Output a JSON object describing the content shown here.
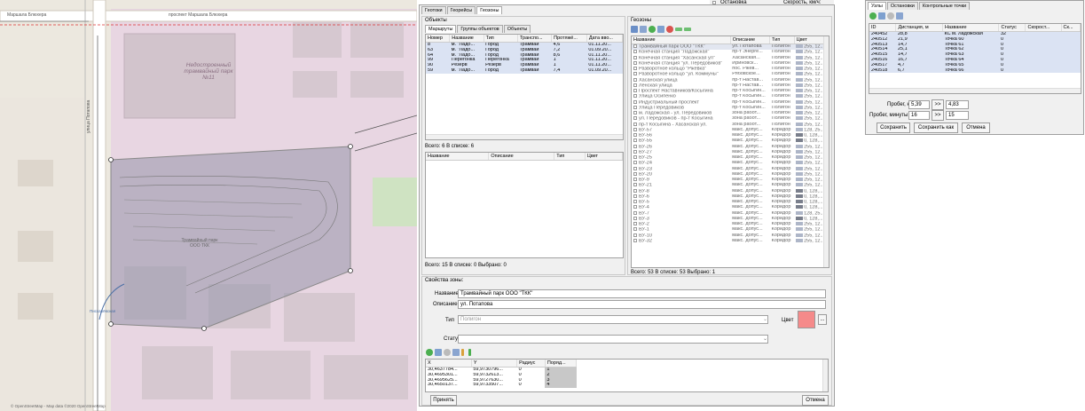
{
  "map": {
    "street_top": "проспект Маршала Блюхера",
    "street_left": "Маршала Блюхера",
    "street_vertical": "улица Потапова",
    "building_label": "Недостроенный трамвайный парк №11",
    "depot_label": "Трамвайный парк ООО ТКК",
    "street_bottom": "Пискарёвская",
    "attribution": "© OpenStreetMap - Map data ©2020 OpenStreetMap"
  },
  "top_strip": {
    "checkbox_label": "Остановка",
    "speed_label": "Скорость, км/ч:"
  },
  "main_tabs": [
    "Геотоки",
    "Георейсы",
    "Геозоны"
  ],
  "objects": {
    "title": "Объекты",
    "tabs": [
      "Маршруты",
      "Группы объектов",
      "Объекты"
    ],
    "columns": [
      "Номер",
      "Название",
      "Тип",
      "Транспо...",
      "Протяжё...",
      "Дата вво..."
    ],
    "rows": [
      [
        "8",
        "м. \"Ладо...",
        "Город",
        "Трамваи",
        "4,6",
        "01.11.20..."
      ],
      [
        "63",
        "м. \"Ладо...",
        "Город",
        "Трамваи",
        "7,2",
        "01.09.20..."
      ],
      [
        "64",
        "м. \"Ладо...",
        "Город",
        "Трамваи",
        "8,6",
        "01.11.20..."
      ],
      [
        "99",
        "Перегонка",
        "Перегонка",
        "Трамваи",
        "1",
        "01.11.20..."
      ],
      [
        "90",
        "Резерв",
        "Резерв",
        "Трамваи",
        "1",
        "01.11.20..."
      ],
      [
        "59",
        "м. \"Ладо...",
        "Город",
        "Трамваи",
        "7,4",
        "01.09.20..."
      ]
    ],
    "count_text": "Всего: 6  В списке: 6",
    "sub_columns": [
      "Название",
      "Описание",
      "Тип",
      "Цвет"
    ],
    "bottom_count": "Всего: 15  В списке: 0  Выбрано: 0"
  },
  "geozones": {
    "title": "Геозоны",
    "columns": [
      "Название",
      "Описание",
      "Тип",
      "Цвет"
    ],
    "rows": [
      [
        "Трамвайный парк ООО \"ТКК\"",
        "ул. Потапова",
        "Полигон",
        "255, 12..."
      ],
      [
        "Конечная станция \"Ладожская\"",
        "пр-т Энерге...",
        "Полигон",
        "255, 12..."
      ],
      [
        "Конечная станция \"Хасанская ул\"",
        "Хасанская...",
        "Полигон",
        "255, 12..."
      ],
      [
        "Конечная станция \"ул. Передовиков\"",
        "Ириновск...",
        "Полигон",
        "255, 12..."
      ],
      [
        "Разворотное кольцо \"Ржевка\"",
        "пос. Ржев...",
        "Полигон",
        "255, 12..."
      ],
      [
        "Разворотное кольцо \"ул. Коммуны\"",
        "Рябовское...",
        "Полигон",
        "255, 12..."
      ],
      [
        "Хасанская улица",
        "пр-т Настав...",
        "Полигон",
        "255, 12..."
      ],
      [
        "Ленская улица",
        "пр-т Настав...",
        "Полигон",
        "255, 12..."
      ],
      [
        "Проспект Наставников/Косыгина",
        "пр-т Косыгин...",
        "Полигон",
        "255, 12..."
      ],
      [
        "Улица Осипенко",
        "пр-т Косыгин...",
        "Полигон",
        "255, 12..."
      ],
      [
        "Индустриальный проспект",
        "пр-т Косыгин...",
        "Полигон",
        "255, 12..."
      ],
      [
        "Улица Передовиков",
        "пр-т Косыгин...",
        "Полигон",
        "255, 12..."
      ],
      [
        "м. Ладожская - ул. Передовиков",
        "зона работ...",
        "Полигон",
        "255, 12..."
      ],
      [
        "ул. Передовиков - пр-т Косыгина",
        "зона работ...",
        "Полигон",
        "255, 12..."
      ],
      [
        "пр-т Косыгина - Хасанская ул.",
        "зона работ...",
        "Полигон",
        "255, 12..."
      ],
      [
        "ВУ-57",
        "макс. допус...",
        "Коридор",
        "128, 25..."
      ],
      [
        "ВУ-56",
        "макс. допус...",
        "Коридор",
        "0, 128,..."
      ],
      [
        "ВУ-55",
        "макс. допус...",
        "Коридор",
        "0, 128,..."
      ],
      [
        "ВУ-26",
        "макс. допус...",
        "Коридор",
        "255, 12..."
      ],
      [
        "ВУ-27",
        "макс. допус...",
        "Коридор",
        "255, 12..."
      ],
      [
        "ВУ-25",
        "макс. допус...",
        "Коридор",
        "255, 12..."
      ],
      [
        "ВУ-24",
        "макс. допус...",
        "Коридор",
        "255, 12..."
      ],
      [
        "ВУ-23",
        "макс. допус...",
        "Коридор",
        "255, 12..."
      ],
      [
        "ВУ-20",
        "макс. допус...",
        "Коридор",
        "255, 12..."
      ],
      [
        "ВУ-9",
        "макс. допус...",
        "Коридор",
        "255, 12..."
      ],
      [
        "ВУ-21",
        "макс. допус...",
        "Коридор",
        "255, 12..."
      ],
      [
        "ВУ-8",
        "макс. допус...",
        "Коридор",
        "0, 128,..."
      ],
      [
        "ВУ-6",
        "макс. допус...",
        "Коридор",
        "0, 128,..."
      ],
      [
        "ВУ-5",
        "макс. допус...",
        "Коридор",
        "0, 128,..."
      ],
      [
        "ВУ-4",
        "макс. допус...",
        "Коридор",
        "0, 128,..."
      ],
      [
        "ВУ-7",
        "макс. допус...",
        "Коридор",
        "128, 25..."
      ],
      [
        "ВУ-3",
        "макс. допус...",
        "Коридор",
        "0, 128,..."
      ],
      [
        "ВУ-2",
        "макс. допус...",
        "Коридор",
        "255, 12..."
      ],
      [
        "ВУ-1",
        "макс. допус...",
        "Коридор",
        "255, 12..."
      ],
      [
        "ВУ-10",
        "макс. допус...",
        "Коридор",
        "255, 12..."
      ],
      [
        "ВУ-32",
        "макс. допус...",
        "Коридор",
        "255, 12..."
      ]
    ],
    "dark_rows": [
      16,
      17,
      26,
      27,
      28,
      29,
      31
    ],
    "count_text": "Всего: 53  В списке: 53  Выбрано: 1"
  },
  "zone_props": {
    "title": "Свойства зоны:",
    "name_label": "Название",
    "name_value": "Трамвайный парк ООО \"ТКК\"",
    "desc_label": "Описание",
    "desc_value": "ул. Потапова",
    "type_label": "Тип",
    "type_value": "Полигон",
    "color_label": "Цвет",
    "color_value": "#f58a8a",
    "color_button": "...",
    "status_label": "Статус",
    "status_value": "",
    "coord_columns": [
      "X",
      "Y",
      "Радиус",
      "Поряд..."
    ],
    "coord_rows": [
      [
        "30,4637784...",
        "59,9730796...",
        "0",
        "1"
      ],
      [
        "30,4695301...",
        "59,9732613...",
        "0",
        "2"
      ],
      [
        "30,4695625...",
        "59,9727630...",
        "0",
        "3"
      ],
      [
        "30,4650137...",
        "59,9733507...",
        "0",
        "4"
      ]
    ],
    "accept_button": "Принять",
    "cancel_button": "Отмена"
  },
  "right_panel": {
    "tabs": [
      "Узлы",
      "Остановки",
      "Контрольные точки"
    ],
    "columns": [
      "ID",
      "Дистанция, м",
      "Название",
      "Статус",
      "Скорост...",
      "Ск..."
    ],
    "rows": [
      [
        "240452",
        "28,8",
        "КС м. Ладожская",
        "32",
        "",
        ""
      ],
      [
        "240512",
        "21,9",
        "Точка 60",
        "0",
        "",
        ""
      ],
      [
        "240513",
        "14,7",
        "Точка 61",
        "0",
        "",
        ""
      ],
      [
        "240514",
        "25,1",
        "Точка 62",
        "0",
        "",
        ""
      ],
      [
        "240515",
        "14,7",
        "Точка 63",
        "0",
        "",
        ""
      ],
      [
        "240516",
        "16,7",
        "Точка 64",
        "0",
        "",
        ""
      ],
      [
        "240517",
        "4,7",
        "Точка 65",
        "0",
        "",
        ""
      ],
      [
        "240518",
        "6,7",
        "Точка 66",
        "0",
        "",
        ""
      ]
    ],
    "km_label": "Пробег, км:",
    "km_from": "5,39",
    "km_arrow": ">>",
    "km_to": "4,83",
    "min_label": "Пробег, минуты:",
    "min_from": "16",
    "min_arrow": ">>",
    "min_to": "15",
    "save_button": "Сохранить",
    "save_as_button": "Сохранить как",
    "cancel_button": "Отмена"
  }
}
